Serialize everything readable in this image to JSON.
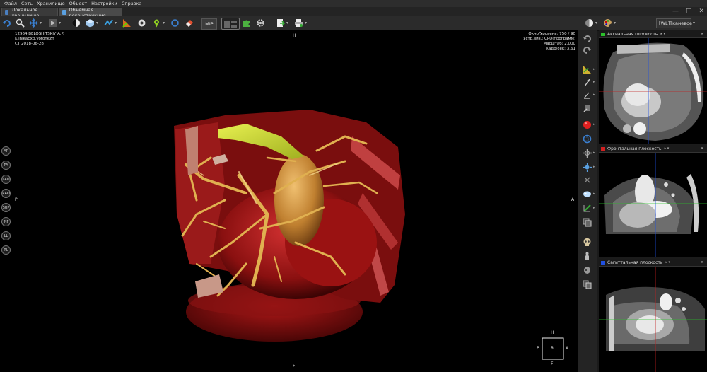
{
  "menu": [
    "Файл",
    "Сеть",
    "Хранилище",
    "Объект",
    "Настройки",
    "Справка"
  ],
  "tabs": [
    {
      "label": "Локальное хранилище"
    },
    {
      "label": "Объемная реконструкция"
    }
  ],
  "window_buttons": [
    "—",
    "□",
    "✕"
  ],
  "toolbar": {
    "mip_label": "MIP",
    "preset_label": "[WL]Тканевое"
  },
  "patient": {
    "name_line": "12964 BELOSHITSKIY A.P.",
    "clinic_line": "KlinikaExp.Voronezh",
    "study_line": "CT 2018-06-28"
  },
  "render_info": {
    "window_line": "Окно/Уровень: 750 / 90",
    "device_line": "Устр.виз.: CPU(программ)",
    "scale_line": "Масштаб: 2.000",
    "fps_line": "Кадр/сек: 3.61"
  },
  "orientation_buttons": [
    "AP",
    "PA",
    "LAO",
    "RAO",
    "SUP",
    "INF",
    "LL",
    "RL"
  ],
  "orientation_markers": {
    "top": "H",
    "bottom": "F",
    "left": "P",
    "right": "A"
  },
  "orientation_cube": {
    "top": "H",
    "bottom": "F",
    "left": "P",
    "right": "A",
    "center": "R"
  },
  "panes": [
    {
      "title": "Аксиальная плоскость",
      "color": "#2bc02b"
    },
    {
      "title": "Фронтальная плоскость",
      "color": "#d02020"
    },
    {
      "title": "Сагиттальная плоскость",
      "color": "#2050e0"
    }
  ],
  "colors": {
    "accent_blue": "#3a7fd0",
    "axial_green": "#2bc02b",
    "coronal_red": "#d02020",
    "sagittal_blue": "#2050e0",
    "vessel_gold": "#e0b050",
    "tissue_red": "#a01010",
    "contrast_yellow": "#d8e040"
  },
  "icons": {
    "left_toolbar": [
      "undo-icon",
      "search-icon",
      "move-icon",
      "play-icon",
      "contrast-icon",
      "cube-icon",
      "navigate-icon",
      "angle-icon",
      "tape-icon",
      "pin-icon",
      "target-icon",
      "eraser-icon"
    ],
    "right_toolbar": [
      "rotate-left-icon",
      "rotate-right-icon",
      "ruler-icon",
      "arrow-icon",
      "angle-measure-icon",
      "text-icon",
      "sphere-icon",
      "fit-icon",
      "crosshair-icon",
      "light-icon",
      "cut-icon",
      "clip-icon",
      "layers-icon",
      "skull-icon",
      "body-icon",
      "copy-icon"
    ]
  }
}
